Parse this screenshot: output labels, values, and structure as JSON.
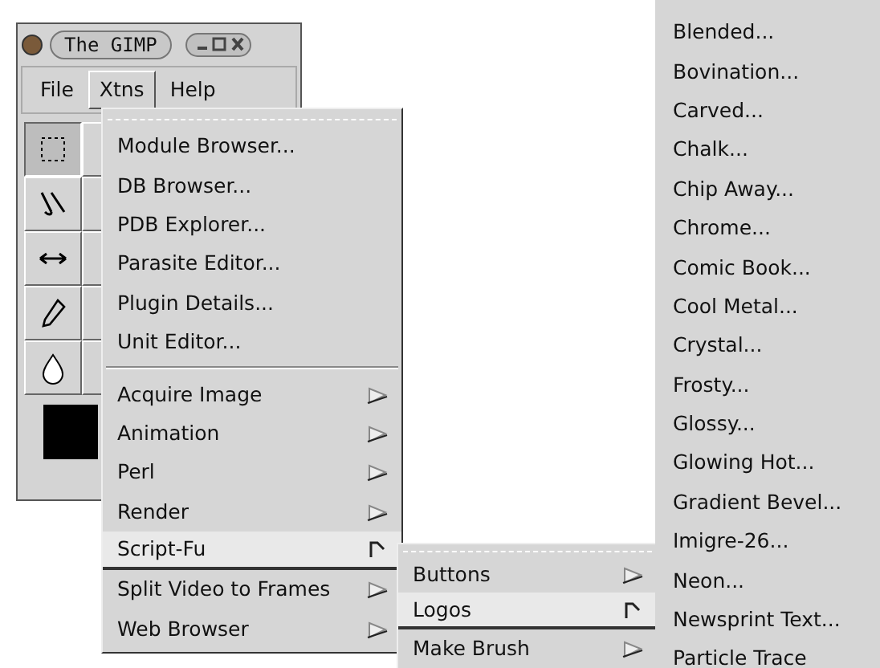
{
  "window": {
    "title": "The GIMP"
  },
  "menubar": [
    {
      "label": "File",
      "selected": false
    },
    {
      "label": "Xtns",
      "selected": true
    },
    {
      "label": "Help",
      "selected": false
    }
  ],
  "tools": [
    {
      "kind": "rect-select",
      "selected": true
    },
    {
      "kind": "paths",
      "selected": false
    },
    {
      "kind": "flip",
      "selected": false
    },
    {
      "kind": "pencil",
      "selected": false
    },
    {
      "kind": "blur",
      "selected": false
    }
  ],
  "xtns_menu": {
    "sections": [
      [
        {
          "label": "Module Browser...",
          "submenu": false,
          "selected": false
        },
        {
          "label": "DB Browser...",
          "submenu": false,
          "selected": false
        },
        {
          "label": "PDB Explorer...",
          "submenu": false,
          "selected": false
        },
        {
          "label": "Parasite Editor...",
          "submenu": false,
          "selected": false
        },
        {
          "label": "Plugin Details...",
          "submenu": false,
          "selected": false
        },
        {
          "label": "Unit Editor...",
          "submenu": false,
          "selected": false
        }
      ],
      [
        {
          "label": "Acquire Image",
          "submenu": true,
          "selected": false
        },
        {
          "label": "Animation",
          "submenu": true,
          "selected": false
        },
        {
          "label": "Perl",
          "submenu": true,
          "selected": false
        },
        {
          "label": "Render",
          "submenu": true,
          "selected": false
        },
        {
          "label": "Script-Fu",
          "submenu": true,
          "selected": true
        },
        {
          "label": "Split Video to Frames",
          "submenu": true,
          "selected": false
        },
        {
          "label": "Web Browser",
          "submenu": true,
          "selected": false
        }
      ]
    ]
  },
  "script_fu_menu": {
    "items": [
      {
        "label": "Buttons",
        "submenu": true,
        "selected": false
      },
      {
        "label": "Logos",
        "submenu": true,
        "selected": true
      },
      {
        "label": "Make Brush",
        "submenu": true,
        "selected": false
      }
    ]
  },
  "logos_menu": {
    "items": [
      {
        "label": "Blended..."
      },
      {
        "label": "Bovination..."
      },
      {
        "label": "Carved..."
      },
      {
        "label": "Chalk..."
      },
      {
        "label": "Chip Away..."
      },
      {
        "label": "Chrome..."
      },
      {
        "label": "Comic Book..."
      },
      {
        "label": "Cool Metal..."
      },
      {
        "label": "Crystal..."
      },
      {
        "label": "Frosty..."
      },
      {
        "label": "Glossy..."
      },
      {
        "label": "Glowing Hot..."
      },
      {
        "label": "Gradient Bevel..."
      },
      {
        "label": "Imigre-26..."
      },
      {
        "label": "Neon..."
      },
      {
        "label": "Newsprint Text..."
      },
      {
        "label": "Particle Trace"
      }
    ]
  }
}
